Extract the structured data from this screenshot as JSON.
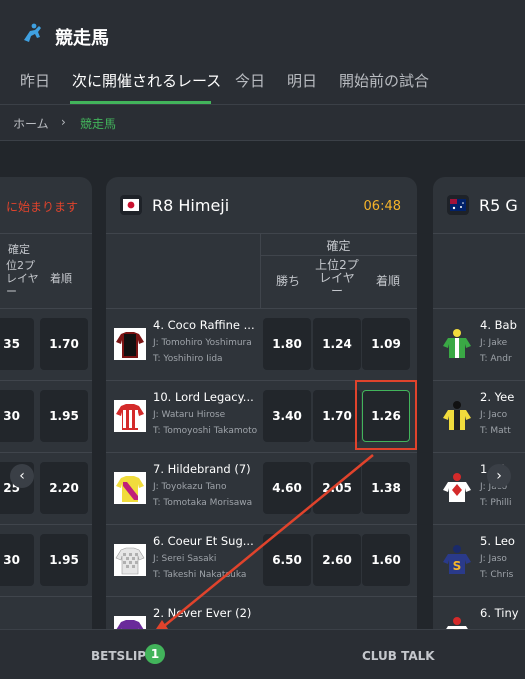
{
  "header": {
    "title": "競走馬",
    "logo_icon": "horse-racing-icon"
  },
  "tabs": [
    {
      "label": "昨日"
    },
    {
      "label": "次に開催されるレース",
      "active": true
    },
    {
      "label": "今日"
    },
    {
      "label": "明日"
    },
    {
      "label": "開始前の試合"
    }
  ],
  "breadcrumb": {
    "home": "ホーム",
    "separator": "›",
    "current": "競走馬"
  },
  "left_card": {
    "time_text": "に始まります",
    "group_label": "確定",
    "col_top2": "位2プ\nレイヤ\nー",
    "col_finish": "着順",
    "rows": [
      {
        "a": "35",
        "b": "1.70"
      },
      {
        "a": "30",
        "b": "1.95"
      },
      {
        "a": "25",
        "b": "2.20"
      },
      {
        "a": "30",
        "b": "1.95"
      }
    ]
  },
  "main_card": {
    "race_name": "R8 Himeji",
    "time": "06:48",
    "group_label": "確定",
    "col_win": "勝ち",
    "col_top2": "上位2プ\nレイヤ\nー",
    "col_finish": "着順",
    "rows": [
      {
        "name": "4. Coco Raffine ...",
        "jockey": "J: Tomohiro Yoshimura",
        "trainer": "T: Yoshihiro Iida",
        "win": "1.80",
        "top2": "1.24",
        "finish": "1.09"
      },
      {
        "name": "10. Lord Legacy...",
        "jockey": "J: Wataru Hirose",
        "trainer": "T: Tomoyoshi Takamoto",
        "win": "3.40",
        "top2": "1.70",
        "finish": "1.26"
      },
      {
        "name": "7. Hildebrand (7)",
        "jockey": "J: Toyokazu Tano",
        "trainer": "T: Tomotaka Morisawa",
        "win": "4.60",
        "top2": "2.05",
        "finish": "1.38"
      },
      {
        "name": "6. Coeur Et Sug...",
        "jockey": "J: Serei Sasaki",
        "trainer": "T: Takeshi Nakatsuka",
        "win": "6.50",
        "top2": "2.60",
        "finish": "1.60"
      },
      {
        "name": "2. Never Ever (2)",
        "jockey": "",
        "trainer": "",
        "win": "",
        "top2": "",
        "finish": ""
      }
    ]
  },
  "right_card": {
    "race_name": "R5 G",
    "rows": [
      {
        "name": "4. Bab",
        "jockey": "J: Jake",
        "trainer": "T: Andr"
      },
      {
        "name": "2. Yee",
        "jockey": "J: Jaco",
        "trainer": "T: Matt"
      },
      {
        "name": "1. M",
        "jockey": "J: Jaco",
        "trainer": "T: Philli"
      },
      {
        "name": "5. Leo",
        "jockey": "J: Jaso",
        "trainer": "T: Chris"
      },
      {
        "name": "6. Tiny",
        "jockey": "",
        "trainer": ""
      }
    ]
  },
  "footer": {
    "betslip": "BETSLIP",
    "betslip_count": "1",
    "club_talk": "CLUB TALK"
  },
  "colors": {
    "accent": "#42b45b",
    "time": "#f5b42a",
    "countdown": "#e0432c",
    "annotation": "#e0432c"
  }
}
